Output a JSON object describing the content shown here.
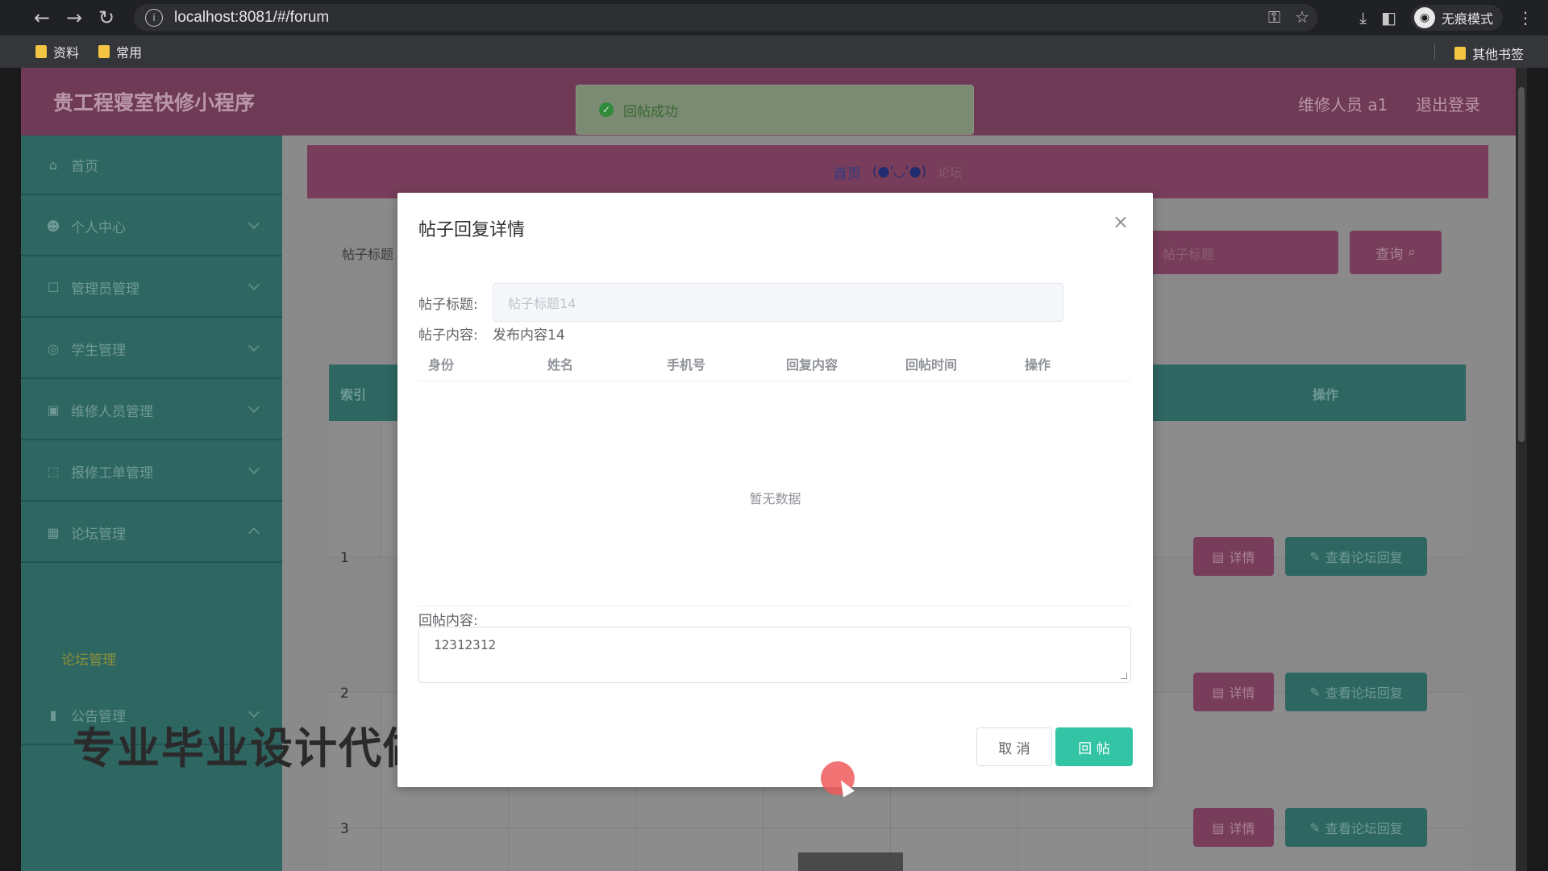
{
  "browser": {
    "url": "localhost:8081/#/forum",
    "incognito_label": "无痕模式",
    "bookmarks": [
      "资料",
      "常用"
    ],
    "other_bookmarks": "其他书签"
  },
  "app": {
    "title": "贵工程寝室快修小程序",
    "user": "维修人员 a1",
    "logout": "退出登录"
  },
  "sidebar": {
    "items": [
      {
        "label": "首页",
        "icon": "home-icon"
      },
      {
        "label": "个人中心",
        "icon": "user-icon"
      },
      {
        "label": "管理员管理",
        "icon": "box-icon"
      },
      {
        "label": "学生管理",
        "icon": "compass-icon"
      },
      {
        "label": "维修人员管理",
        "icon": "image-icon"
      },
      {
        "label": "报修工单管理",
        "icon": "square-icon"
      },
      {
        "label": "论坛管理",
        "icon": "grid-icon"
      },
      {
        "label": "公告管理",
        "icon": "bar-chart-icon"
      }
    ],
    "sub_item": "论坛管理"
  },
  "breadcrumb": {
    "home": "首页",
    "face": "(●'◡'●)",
    "current": "论坛"
  },
  "search": {
    "label": "帖子标题",
    "query_button": "查询"
  },
  "table": {
    "index_header": "索引",
    "ops_header": "操作",
    "rows": [
      {
        "index": "1"
      },
      {
        "index": "2"
      },
      {
        "index": "3"
      }
    ],
    "detail_button": "详情",
    "view_button": "查看论坛回复"
  },
  "watermark": "专业毕业设计代做",
  "toast": {
    "message": "回帖成功"
  },
  "dialog": {
    "title": "帖子回复详情",
    "post_title_label": "帖子标题:",
    "post_title_value": "帖子标题14",
    "post_content_label": "帖子内容:",
    "post_content_value": "发布内容14",
    "columns": [
      "身份",
      "姓名",
      "手机号",
      "回复内容",
      "回帖时间",
      "操作"
    ],
    "empty_text": "暂无数据",
    "reply_label": "回帖内容:",
    "reply_value": "12312312",
    "cancel_button": "取 消",
    "submit_button": "回 帖"
  },
  "colors": {
    "accent_teal": "#32c4a4",
    "header_pink": "#6f3a55",
    "sidebar_teal": "#2e6662",
    "success_green": "#2f8a3a"
  }
}
